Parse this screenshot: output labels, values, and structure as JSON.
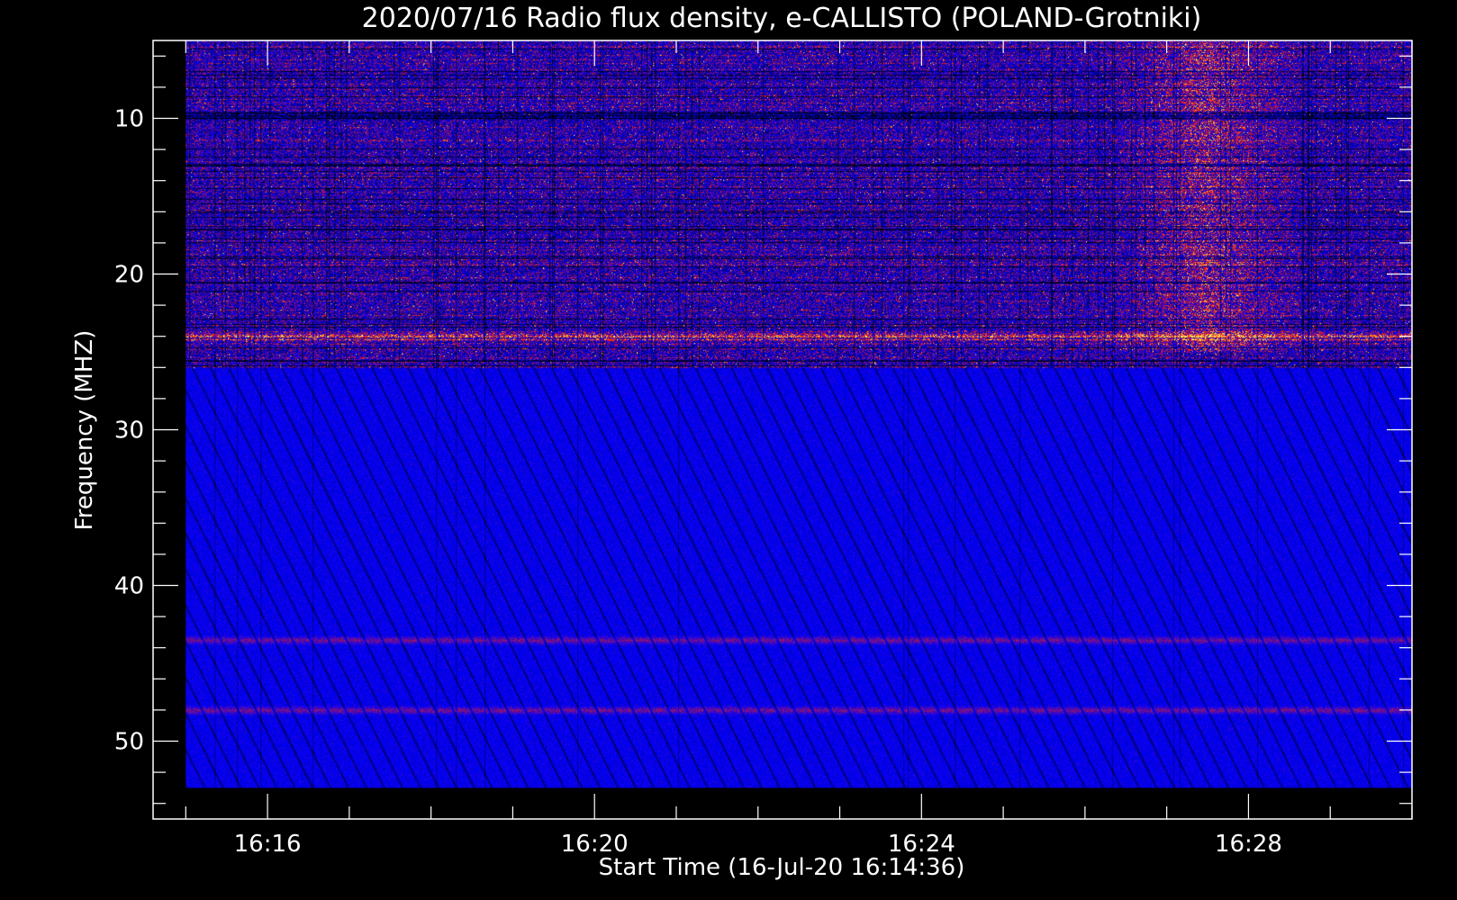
{
  "chart_data": {
    "type": "heatmap",
    "title": "2020/07/16  Radio flux density, e-CALLISTO (POLAND-Grotniki)",
    "xlabel": "Start Time (16-Jul-20 16:14:36)",
    "ylabel": "Frequency (MHZ)",
    "xlim": [
      "16:14:36",
      "16:30:00"
    ],
    "ylim": [
      55,
      5
    ],
    "data_extent": {
      "time": [
        "16:15:00",
        "16:30:00"
      ],
      "frequency_mhz": [
        5,
        53
      ]
    },
    "x_ticks": [
      "16:16",
      "16:20",
      "16:24",
      "16:28"
    ],
    "y_ticks": [
      "10",
      "20",
      "30",
      "40",
      "50"
    ],
    "colormap": [
      "#000000",
      "#0000ff",
      "#ff2200",
      "#ffff66"
    ],
    "features": [
      {
        "kind": "band",
        "freq_from": 5,
        "freq_to": 26,
        "level": "mixed-bright"
      },
      {
        "kind": "band",
        "freq_from": 26,
        "freq_to": 53,
        "level": "low"
      },
      {
        "kind": "line",
        "freq": 9.8,
        "level": "dark"
      },
      {
        "kind": "line",
        "freq": 24,
        "level": "bright"
      },
      {
        "kind": "line",
        "freq": 43.5,
        "level": "medium"
      },
      {
        "kind": "line",
        "freq": 48,
        "level": "medium"
      },
      {
        "kind": "burst",
        "time": "16:27:30",
        "freq_from": 5,
        "freq_to": 25,
        "level": "bright"
      }
    ]
  }
}
